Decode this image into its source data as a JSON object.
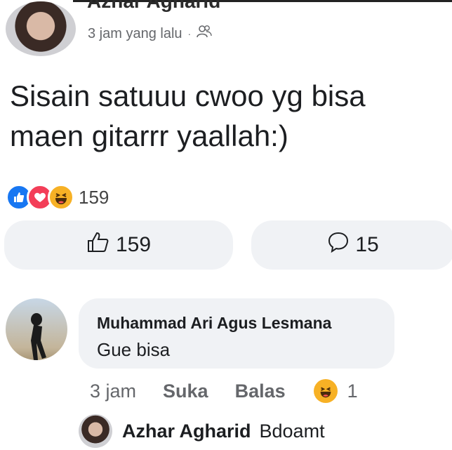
{
  "post": {
    "author": "Azhar Agharid",
    "time": "3 jam yang lalu",
    "separator": "·",
    "privacy_icon": "friends-icon",
    "text": "Sisain satuuu cwoo yg bisa maen gitarrr yaallah:)",
    "reactions": [
      "like-reaction-icon",
      "love-reaction-icon",
      "haha-reaction-icon"
    ],
    "reaction_count": "159"
  },
  "actions": {
    "like_count": "159",
    "comment_count": "15"
  },
  "comment": {
    "author": "Muhammad Ari Agus Lesmana",
    "text": "Gue bisa",
    "time": "3 jam",
    "like_label": "Suka",
    "reply_label": "Balas",
    "reaction_count": "1"
  },
  "reply": {
    "author": "Azhar Agharid",
    "text": "Bdoamt"
  },
  "colors": {
    "like": "#1877f2",
    "love": "#f33e58",
    "haha": "#f7b125",
    "bubble": "#f0f2f5"
  }
}
